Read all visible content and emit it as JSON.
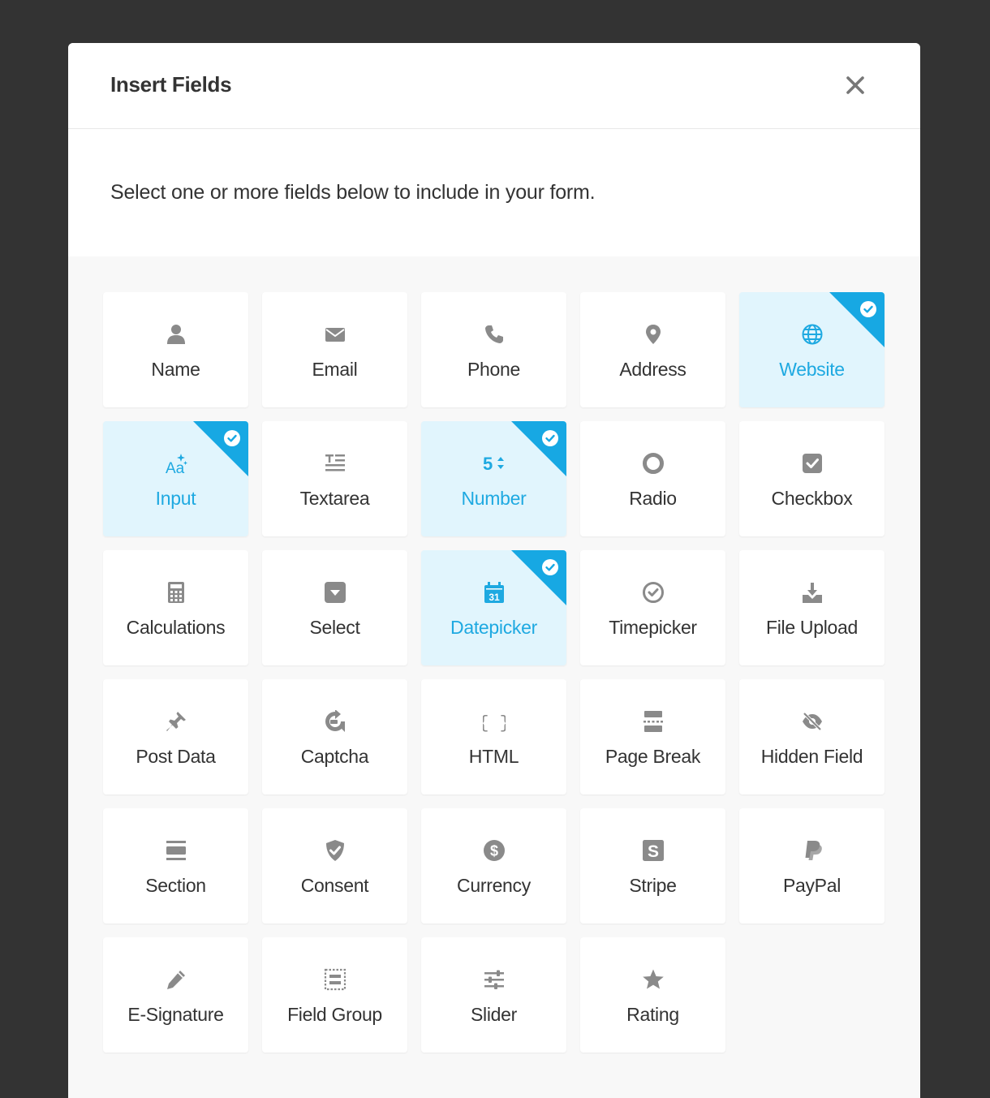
{
  "modal": {
    "title": "Insert Fields",
    "close_icon": "close-icon",
    "intro": "Select one or more fields below to include in your form."
  },
  "colors": {
    "selected_accent": "#1ea9e1",
    "selected_bg": "#e1f5fd",
    "icon_gray": "#8a8a8a"
  },
  "fields": [
    {
      "label": "Name",
      "icon": "user-icon",
      "selected": false
    },
    {
      "label": "Email",
      "icon": "envelope-icon",
      "selected": false
    },
    {
      "label": "Phone",
      "icon": "phone-icon",
      "selected": false
    },
    {
      "label": "Address",
      "icon": "map-pin-icon",
      "selected": false
    },
    {
      "label": "Website",
      "icon": "globe-icon",
      "selected": true
    },
    {
      "label": "Input",
      "icon": "text-input-icon",
      "selected": true
    },
    {
      "label": "Textarea",
      "icon": "textarea-icon",
      "selected": false
    },
    {
      "label": "Number",
      "icon": "number-icon",
      "selected": true
    },
    {
      "label": "Radio",
      "icon": "radio-icon",
      "selected": false
    },
    {
      "label": "Checkbox",
      "icon": "checkbox-icon",
      "selected": false
    },
    {
      "label": "Calculations",
      "icon": "calculator-icon",
      "selected": false
    },
    {
      "label": "Select",
      "icon": "select-dropdown-icon",
      "selected": false
    },
    {
      "label": "Datepicker",
      "icon": "calendar-icon",
      "selected": true
    },
    {
      "label": "Timepicker",
      "icon": "clock-icon",
      "selected": false
    },
    {
      "label": "File Upload",
      "icon": "upload-icon",
      "selected": false
    },
    {
      "label": "Post Data",
      "icon": "pin-icon",
      "selected": false
    },
    {
      "label": "Captcha",
      "icon": "captcha-icon",
      "selected": false
    },
    {
      "label": "HTML",
      "icon": "code-braces-icon",
      "selected": false
    },
    {
      "label": "Page Break",
      "icon": "page-break-icon",
      "selected": false
    },
    {
      "label": "Hidden Field",
      "icon": "eye-slash-icon",
      "selected": false
    },
    {
      "label": "Section",
      "icon": "section-icon",
      "selected": false
    },
    {
      "label": "Consent",
      "icon": "shield-check-icon",
      "selected": false
    },
    {
      "label": "Currency",
      "icon": "dollar-icon",
      "selected": false
    },
    {
      "label": "Stripe",
      "icon": "stripe-icon",
      "selected": false
    },
    {
      "label": "PayPal",
      "icon": "paypal-icon",
      "selected": false
    },
    {
      "label": "E-Signature",
      "icon": "pencil-icon",
      "selected": false
    },
    {
      "label": "Field Group",
      "icon": "field-group-icon",
      "selected": false
    },
    {
      "label": "Slider",
      "icon": "slider-icon",
      "selected": false
    },
    {
      "label": "Rating",
      "icon": "star-icon",
      "selected": false
    }
  ]
}
